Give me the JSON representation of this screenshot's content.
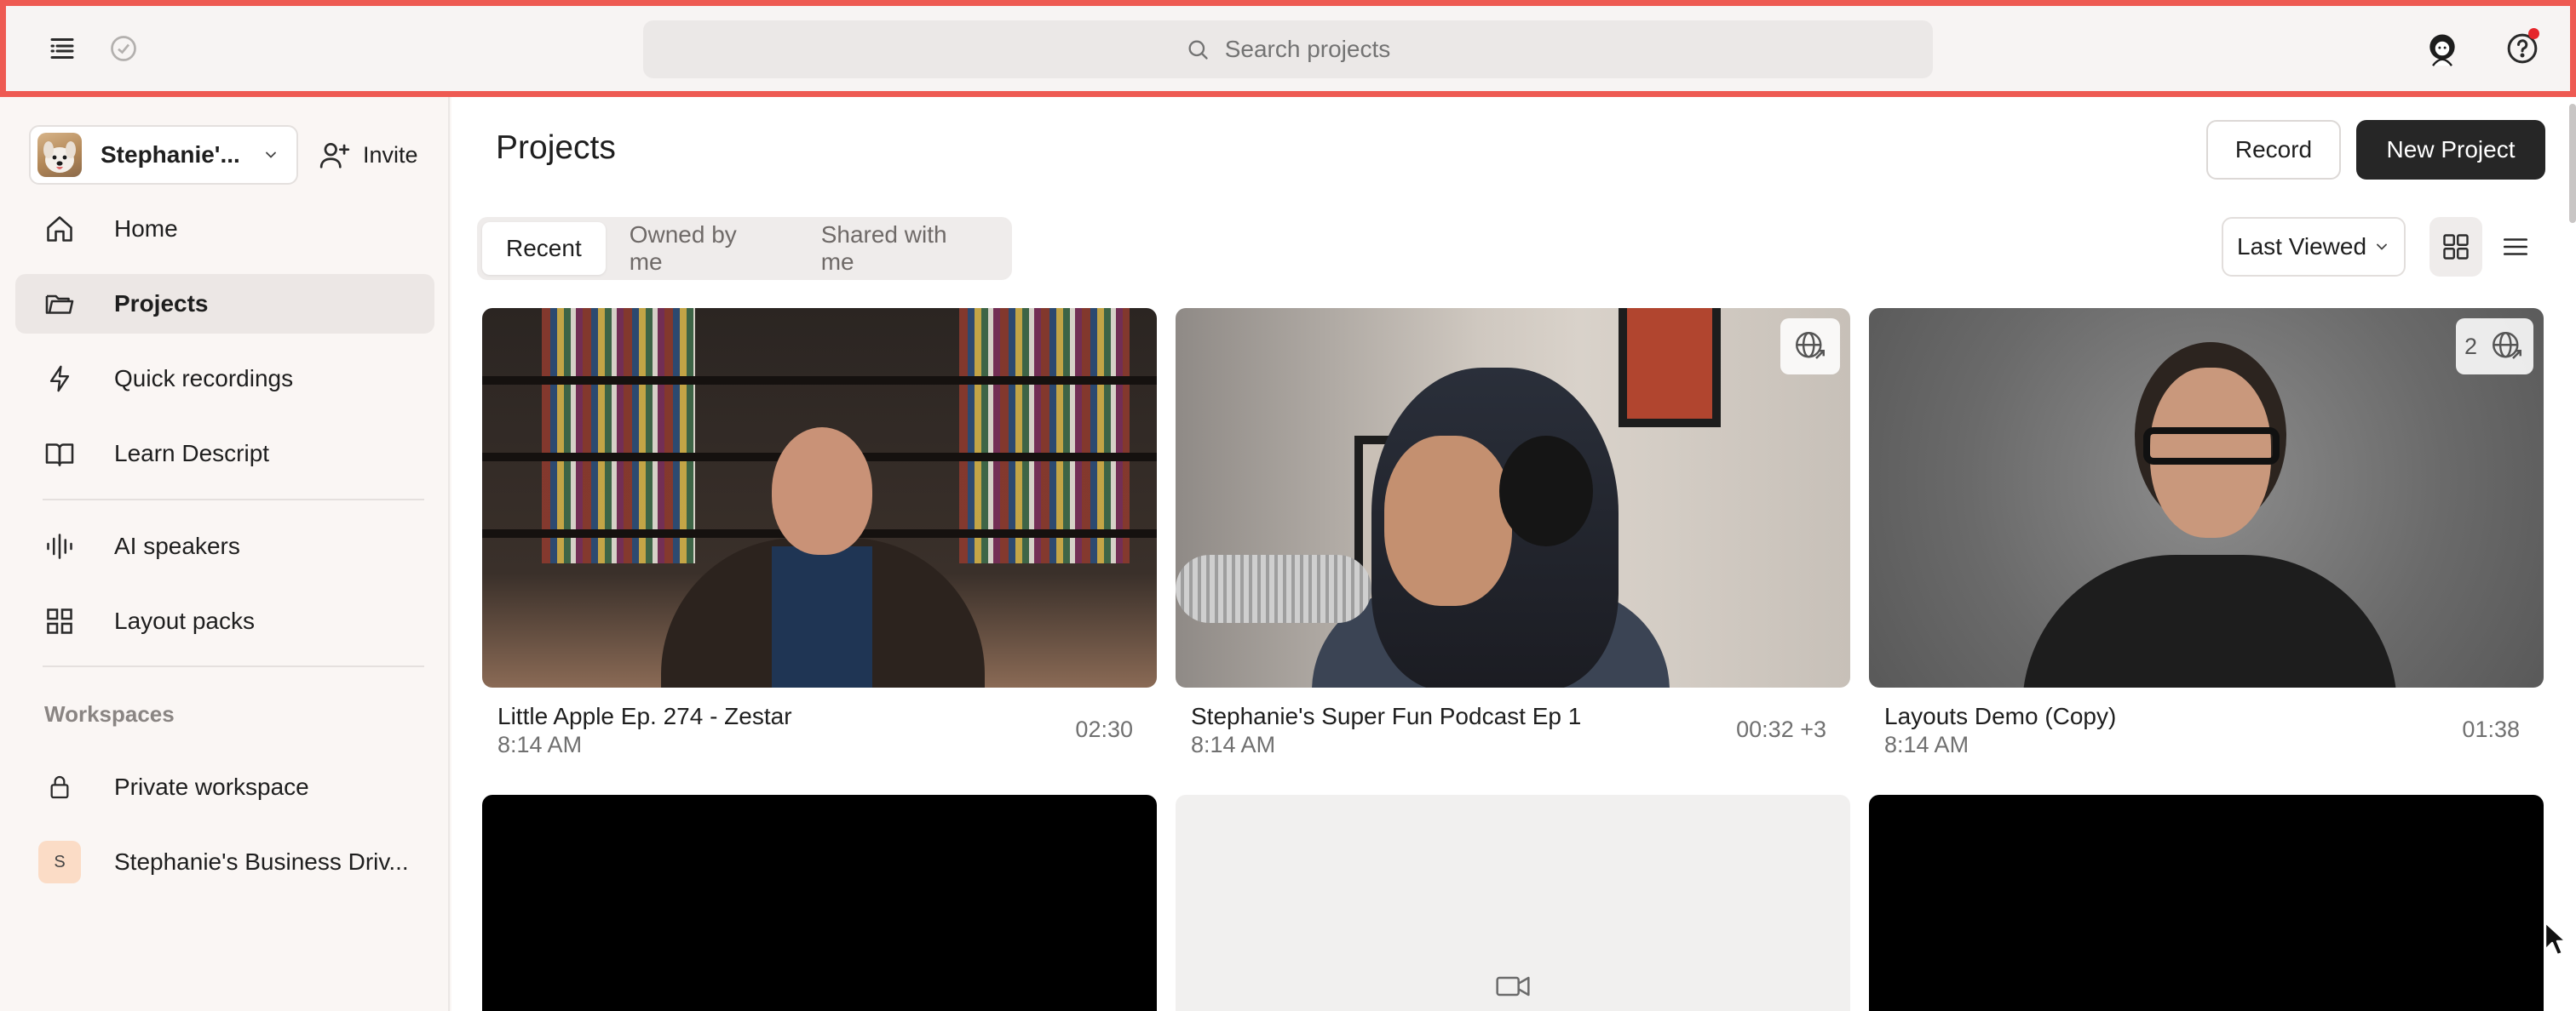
{
  "topbar": {
    "search_placeholder": "Search projects",
    "icons": [
      "menu-icon",
      "check-circle-icon",
      "search-icon",
      "user-avatar-icon",
      "help-icon"
    ],
    "notification_color": "#e5262b"
  },
  "sidebar": {
    "workspace_name": "Stephanie'...",
    "invite_label": "Invite",
    "nav": [
      {
        "label": "Home",
        "icon": "home-icon"
      },
      {
        "label": "Projects",
        "icon": "folder-icon",
        "active": true
      },
      {
        "label": "Quick recordings",
        "icon": "lightning-icon"
      },
      {
        "label": "Learn Descript",
        "icon": "book-icon"
      },
      {
        "label": "AI speakers",
        "icon": "waveform-icon"
      },
      {
        "label": "Layout packs",
        "icon": "grid-icon"
      }
    ],
    "workspaces_label": "Workspaces",
    "workspaces": [
      {
        "label": "Private workspace",
        "icon": "lock-icon"
      },
      {
        "label": "Stephanie's Business Driv...",
        "badge": "S"
      }
    ]
  },
  "main": {
    "title": "Projects",
    "record_label": "Record",
    "new_project_label": "New Project",
    "tabs": [
      {
        "label": "Recent",
        "active": true
      },
      {
        "label": "Owned by me"
      },
      {
        "label": "Shared with me"
      }
    ],
    "sort_label": "Last Viewed",
    "projects": [
      {
        "title": "Little Apple Ep. 274 - Zestar",
        "time": "8:14 AM",
        "duration": "02:30"
      },
      {
        "title": "Stephanie's Super Fun Podcast Ep 1",
        "time": "8:14 AM",
        "duration": "00:32 +3",
        "shared": true
      },
      {
        "title": "Layouts Demo (Copy)",
        "time": "8:14 AM",
        "duration": "01:38",
        "shared": true,
        "share_count": "2"
      }
    ]
  },
  "colors": {
    "accent_border": "#ee5a52",
    "primary_button": "#262626",
    "sidebar_bg": "#faf6f4"
  }
}
